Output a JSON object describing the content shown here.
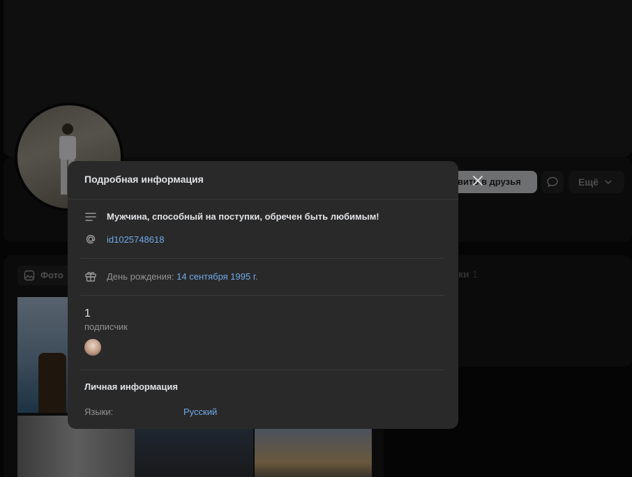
{
  "page": {
    "add_friend_label": "Добавить в друзья",
    "add_friend_visible": "вить в друзья",
    "more_label": "Ещё",
    "photos_tab_label": "Фото",
    "friends_label": "ки",
    "friends_count": "1"
  },
  "modal": {
    "title": "Подробная информация",
    "status": "Мужчина, способный на поступки, обречен быть любимым!",
    "id_link": "id1025748618",
    "birthday_label": "День рождения:",
    "birthday_value": "14 сентября 1995 г.",
    "followers_count": "1",
    "followers_label": "подписчик",
    "personal_section_title": "Личная информация",
    "languages_label": "Языки:",
    "languages_value": "Русский"
  },
  "icons": {
    "close": "close-icon",
    "status": "text-lines-icon",
    "id": "at-sign-icon",
    "birthday": "gift-icon",
    "message": "chat-bubble-icon",
    "more": "chevron-down-icon",
    "photos": "image-icon"
  },
  "colors": {
    "link": "#71aaeb",
    "modal_bg": "#292929",
    "text_primary": "#e1e3e6",
    "text_secondary": "#939393"
  }
}
